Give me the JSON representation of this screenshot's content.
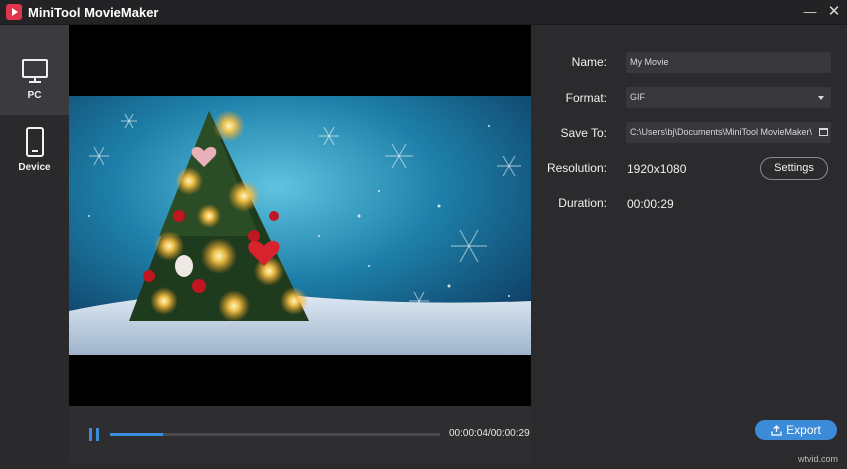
{
  "window": {
    "title": "MiniTool MovieMaker",
    "minimize_glyph": "—",
    "close_glyph": "✕"
  },
  "sidebar": {
    "items": [
      {
        "label": "PC",
        "icon": "monitor-icon",
        "selected": true
      },
      {
        "label": "Device",
        "icon": "phone-icon",
        "selected": false
      }
    ]
  },
  "player": {
    "current_time": "00:00:04",
    "total_time": "00:00:29",
    "timecode": "00:00:04/00:00:29",
    "progress": 0.16,
    "state": "playing",
    "frame": "christmas-tree-snow-scene"
  },
  "export_settings": {
    "name_label": "Name:",
    "name_value": "My Movie",
    "format_label": "Format:",
    "format_value": "GIF",
    "save_to_label": "Save To:",
    "save_to_value": "C:\\Users\\bj\\Documents\\MiniTool MovieMaker\\",
    "resolution_label": "Resolution:",
    "resolution_value": "1920x1080",
    "settings_button": "Settings",
    "duration_label": "Duration:",
    "duration_value": "00:00:29",
    "export_button": "Export"
  },
  "colors": {
    "accent": "#3b8bd8",
    "background": "#2b2b2e",
    "logo": "#e0354a"
  },
  "watermark": "wtvid.com"
}
